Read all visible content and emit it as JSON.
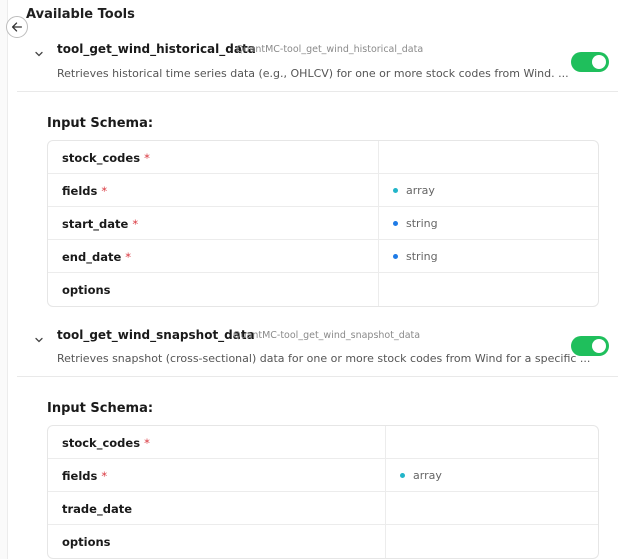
{
  "header": {
    "title": "Available Tools"
  },
  "colors": {
    "toggle_on": "#1fbf5c",
    "required": "#d9363e",
    "type_array": "#22b5c9",
    "type_string": "#1e7be6"
  },
  "tools": [
    {
      "name": "tool_get_wind_historical_data",
      "id": "QuantMC-tool_get_wind_historical_data",
      "description": "Retrieves historical time series data (e.g., OHLCV) for one or more stock codes from Wind. ...",
      "enabled": true,
      "schema_title": "Input Schema:",
      "fields": [
        {
          "name": "stock_codes",
          "required_mark": "*",
          "type": ""
        },
        {
          "name": "fields",
          "required_mark": "*",
          "type": "array"
        },
        {
          "name": "start_date",
          "required_mark": "*",
          "type": "string"
        },
        {
          "name": "end_date",
          "required_mark": "*",
          "type": "string"
        },
        {
          "name": "options",
          "required_mark": "",
          "type": ""
        }
      ]
    },
    {
      "name": "tool_get_wind_snapshot_data",
      "id": "QuantMC-tool_get_wind_snapshot_data",
      "description": "Retrieves snapshot (cross-sectional) data for one or more stock codes from Wind for a specific ...",
      "enabled": true,
      "schema_title": "Input Schema:",
      "fields": [
        {
          "name": "stock_codes",
          "required_mark": "*",
          "type": ""
        },
        {
          "name": "fields",
          "required_mark": "*",
          "type": "array"
        },
        {
          "name": "trade_date",
          "required_mark": "",
          "type": ""
        },
        {
          "name": "options",
          "required_mark": "",
          "type": ""
        }
      ]
    }
  ]
}
